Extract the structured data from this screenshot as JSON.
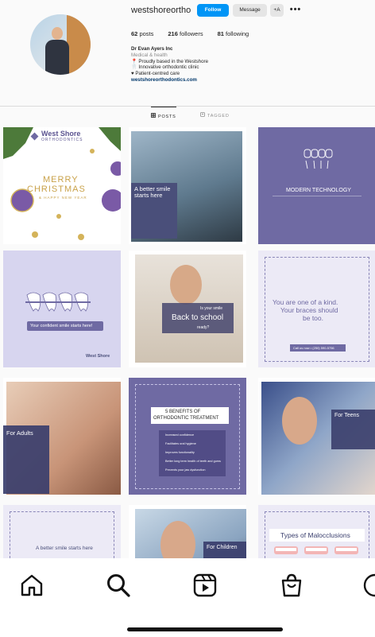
{
  "profile": {
    "username": "westshoreortho",
    "follow_label": "Follow",
    "message_label": "Message",
    "add_user_label": "+A",
    "more_label": "•••",
    "stats": {
      "posts_count": "62",
      "posts_label": "posts",
      "followers_count": "216",
      "followers_label": "followers",
      "following_count": "81",
      "following_label": "following"
    },
    "bio": {
      "name": "Dr Evan Ayers Inc",
      "category": "Medical & health",
      "line1": "📍 Proudly based in the Westshore",
      "line2": "🦷 Innovative orthodontic clinic",
      "line3": "♥ Patient-centred care",
      "link": "westshoreorthodontics.com"
    }
  },
  "tabs": [
    {
      "label": "POSTS",
      "icon": "grid-icon",
      "active": true
    },
    {
      "label": "TAGGED",
      "icon": "tag-icon",
      "active": false
    }
  ],
  "posts": {
    "p1": {
      "brand": "West Shore",
      "brand_sub": "ORTHODONTICS",
      "line1": "MERRY",
      "line2": "CHRISTMAS",
      "line3": "& HAPPY NEW YEAR"
    },
    "p2": {
      "headline": "A better smile starts here"
    },
    "p3": {
      "headline": "MODERN TECHNOLOGY"
    },
    "p4": {
      "caption": "Your confident smile starts here!",
      "brand": "West Shore"
    },
    "p5": {
      "line1": "Is your smile",
      "line2": "Back to school",
      "line3": "ready?"
    },
    "p6": {
      "line1": "You are one of a kind.",
      "line2": "Your braces should",
      "line3": "be too.",
      "cta": "Call us now • (250) 590-5756"
    },
    "p7": {
      "headline": "For Adults"
    },
    "p8": {
      "line1": "5 BENEFITS OF",
      "line2": "ORTHODONTIC TREATMENT",
      "items": [
        "Increased confidence",
        "Facilitates oral hygiene",
        "Improves functionality",
        "Better long term health of teeth and gums",
        "Prevents your jaw dysfunction"
      ]
    },
    "p9": {
      "headline": "For Teens"
    },
    "p10": {
      "headline": "A better smile starts here"
    },
    "p11": {
      "headline": "For Children"
    },
    "p12": {
      "headline": "Types of Malocclusions"
    }
  },
  "nav": {
    "items": [
      {
        "name": "home-icon"
      },
      {
        "name": "search-icon"
      },
      {
        "name": "reels-icon"
      },
      {
        "name": "shop-icon"
      },
      {
        "name": "profile-icon"
      }
    ]
  },
  "colors": {
    "accent": "#0095f6",
    "brand_purple": "#6f6aa3",
    "lavender": "#d7d5ef"
  }
}
